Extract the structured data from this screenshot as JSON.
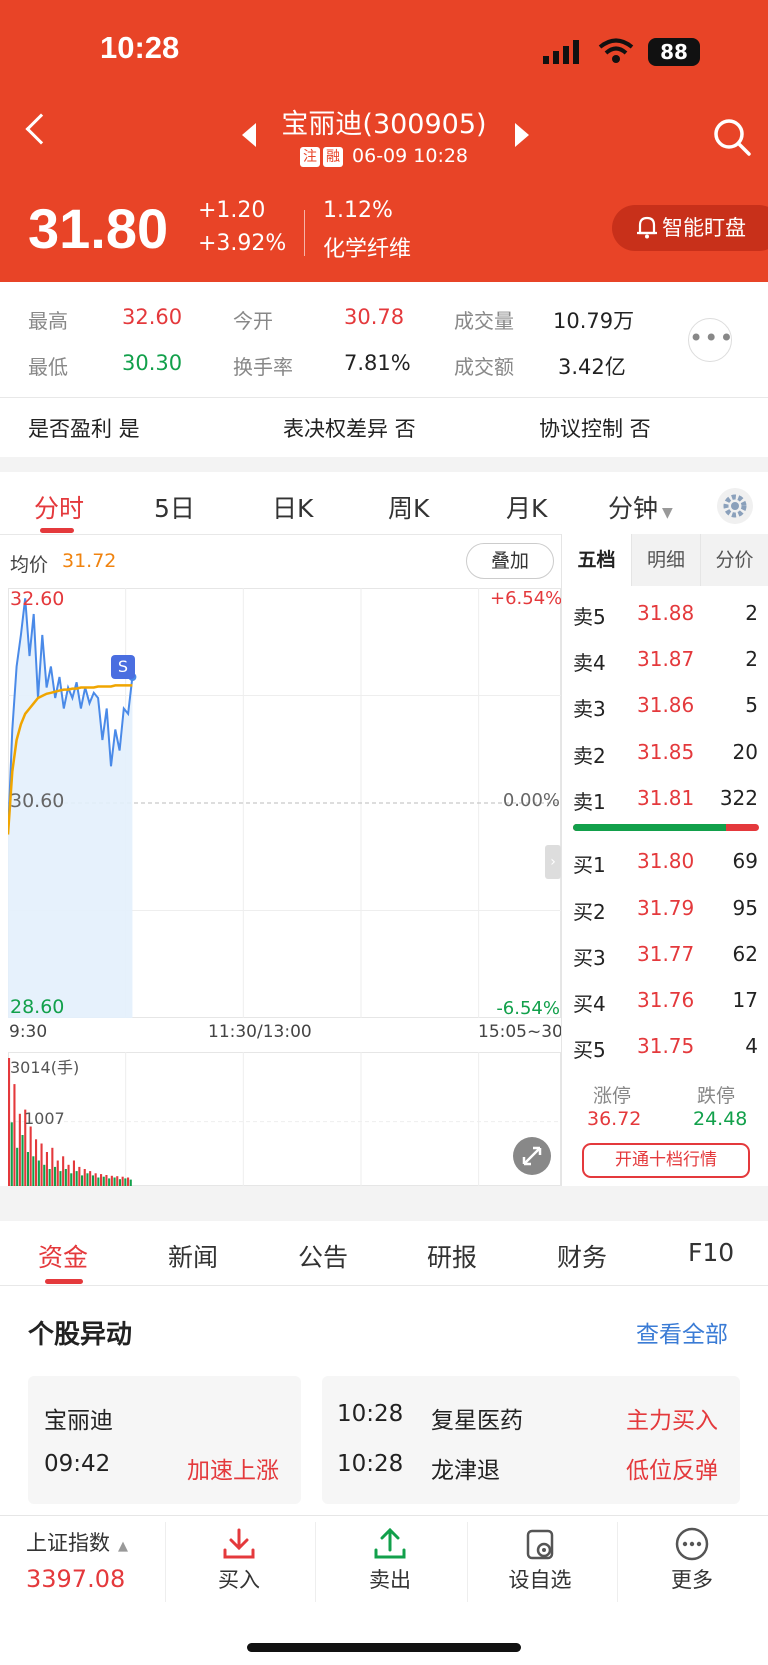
{
  "status_bar": {
    "time": "10:28",
    "battery": "88"
  },
  "header": {
    "title": "宝丽迪(300905)",
    "tag1": "注",
    "tag2": "融",
    "datetime": "06-09 10:28",
    "price": "31.80",
    "change": "+1.20",
    "change_pct": "+3.92%",
    "turnover_pct": "1.12%",
    "industry": "化学纤维",
    "watch_label": "智能盯盘"
  },
  "stats": {
    "high_label": "最高",
    "high": "32.60",
    "open_label": "今开",
    "open": "30.78",
    "volume_label": "成交量",
    "volume": "10.79万",
    "low_label": "最低",
    "low": "30.30",
    "turnover_label": "换手率",
    "turnover": "7.81%",
    "amount_label": "成交额",
    "amount": "3.42亿"
  },
  "info": {
    "profit": "是否盈利 是",
    "voting": "表决权差异 否",
    "control": "协议控制 否"
  },
  "chart_tabs": [
    "分时",
    "5日",
    "日K",
    "周K",
    "月K",
    "分钟"
  ],
  "chart_header": {
    "avg_label": "均价",
    "avg_value": "31.72",
    "overlay_label": "叠加"
  },
  "chart_data": {
    "type": "line",
    "ylim": [
      28.6,
      32.6
    ],
    "y_labels": {
      "top": "32.60",
      "mid": "30.60",
      "bottom": "28.60"
    },
    "pct_labels": {
      "top": "+6.54%",
      "mid": "0.00%",
      "bottom": "-6.54%"
    },
    "x_labels": [
      "9:30",
      "11:30/13:00",
      "15:05~30"
    ],
    "series": [
      {
        "values": [
          30.3,
          31.3,
          31.9,
          32.2,
          32.55,
          32.0,
          32.4,
          31.6,
          32.2,
          31.7,
          31.9,
          31.6,
          31.8,
          31.5,
          31.7,
          31.6,
          31.75,
          31.5,
          31.7,
          31.55,
          31.65,
          31.6,
          31.2,
          31.5,
          30.95,
          31.3,
          31.1,
          31.5,
          31.45,
          31.8
        ]
      },
      {
        "values": [
          30.3,
          30.9,
          31.2,
          31.35,
          31.45,
          31.5,
          31.55,
          31.6,
          31.62,
          31.64,
          31.65,
          31.66,
          31.67,
          31.68,
          31.68,
          31.69,
          31.69,
          31.7,
          31.7,
          31.7,
          31.7,
          31.71,
          31.71,
          31.71,
          31.71,
          31.72,
          31.72,
          31.72,
          31.72,
          31.72
        ]
      }
    ],
    "sell_marker": "S",
    "volume_max_label": "3014(手)",
    "volume_mid_label": "1007",
    "volume_max": 3014,
    "volumes": [
      3014,
      1500,
      2400,
      900,
      1700,
      1200,
      1800,
      800,
      1400,
      700,
      1100,
      600,
      1000,
      500,
      800,
      400,
      900,
      450,
      600,
      350,
      700,
      400,
      500,
      300,
      600,
      350,
      450,
      250,
      400,
      300,
      350,
      250,
      300,
      200,
      280,
      220,
      260,
      180,
      240,
      200,
      230,
      160,
      220,
      180,
      200,
      150
    ],
    "volume_colors": [
      "#e4393c",
      "#12a04b"
    ]
  },
  "orderbook": {
    "tabs": [
      "五档",
      "明细",
      "分价"
    ],
    "asks": [
      {
        "label": "卖5",
        "price": "31.88",
        "vol": "2"
      },
      {
        "label": "卖4",
        "price": "31.87",
        "vol": "2"
      },
      {
        "label": "卖3",
        "price": "31.86",
        "vol": "5"
      },
      {
        "label": "卖2",
        "price": "31.85",
        "vol": "20"
      },
      {
        "label": "卖1",
        "price": "31.81",
        "vol": "322"
      }
    ],
    "bids": [
      {
        "label": "买1",
        "price": "31.80",
        "vol": "69"
      },
      {
        "label": "买2",
        "price": "31.79",
        "vol": "95"
      },
      {
        "label": "买3",
        "price": "31.77",
        "vol": "62"
      },
      {
        "label": "买4",
        "price": "31.76",
        "vol": "17"
      },
      {
        "label": "买5",
        "price": "31.75",
        "vol": "4"
      }
    ],
    "buy_ratio": 0.82,
    "limit_up_label": "涨停",
    "limit_up": "36.72",
    "limit_down_label": "跌停",
    "limit_down": "24.48",
    "ten_level_button": "开通十档行情"
  },
  "bottom_tabs": [
    "资金",
    "新闻",
    "公告",
    "研报",
    "财务",
    "F10"
  ],
  "alerts": {
    "title": "个股异动",
    "view_all": "查看全部",
    "left": {
      "name": "宝丽迪",
      "time": "09:42",
      "event": "加速上涨"
    },
    "right": [
      {
        "time": "10:28",
        "name": "复星医药",
        "event": "主力买入"
      },
      {
        "time": "10:28",
        "name": "龙津退",
        "event": "低位反弹"
      }
    ]
  },
  "bottom_bar": {
    "index_name": "上证指数",
    "index_value": "3397.08",
    "buy": "买入",
    "sell": "卖出",
    "watchlist": "设自选",
    "more": "更多"
  },
  "colors": {
    "header_bg": "#e84427",
    "up": "#e4393c",
    "down": "#12a04b",
    "avg": "#f0a500",
    "price_line": "#4a8ae8"
  }
}
